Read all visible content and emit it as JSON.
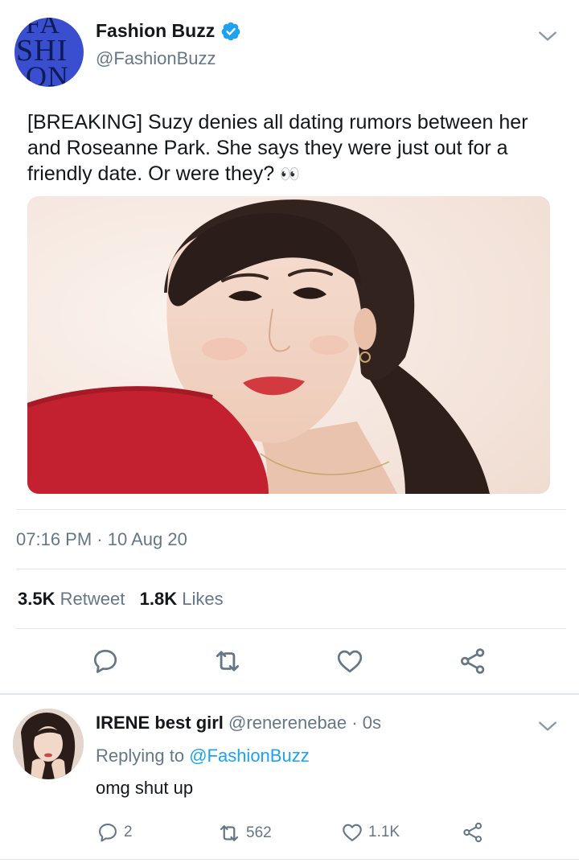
{
  "tweet": {
    "account_name": "Fashion Buzz",
    "handle": "@FashionBuzz",
    "avatar_text": [
      "FA",
      "SHI",
      "ON"
    ],
    "text_main": "[BREAKING] Suzy denies all dating rumors between her and Roseanne Park. She says they were just out for a friendly date. Or were they?",
    "emoji": "👀",
    "timestamp": "07:16 PM · 10 Aug 20",
    "retweet_count": "3.5K",
    "retweet_label": "Retweet",
    "like_count": "1.8K",
    "like_label": "Likes",
    "colors": {
      "verified": "#1da1f2",
      "icon": "#657786",
      "link": "#1da1f2"
    }
  },
  "reply": {
    "name": "IRENE best girl",
    "handle": "@renerenebae",
    "time": " · 0s",
    "replying_label": "Replying to ",
    "replying_to": "@FashionBuzz",
    "text": "omg shut up",
    "reply_count": "2",
    "retweet_count": "562",
    "like_count": "1.1K"
  }
}
